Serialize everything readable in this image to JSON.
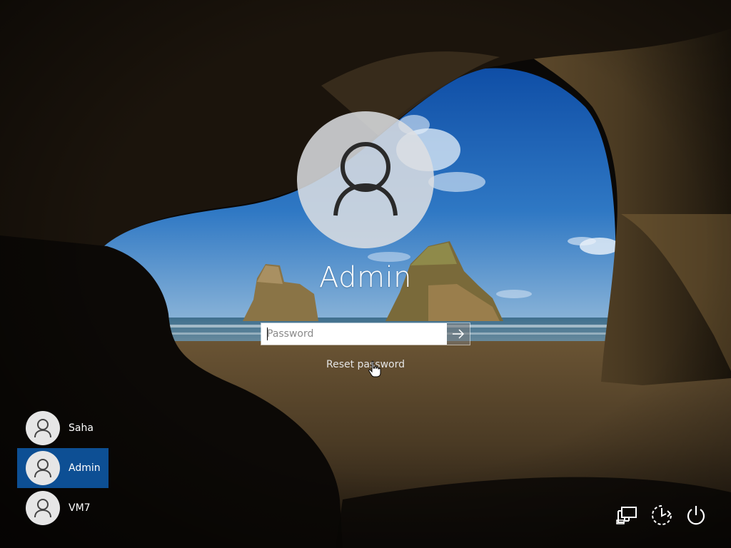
{
  "login": {
    "selected_user": "Admin",
    "password_placeholder": "Password",
    "password_value": "",
    "reset_link": "Reset password"
  },
  "users": [
    {
      "name": "Saha",
      "selected": false
    },
    {
      "name": "Admin",
      "selected": true
    },
    {
      "name": "VM7",
      "selected": false
    }
  ],
  "tray": [
    {
      "icon": "network-icon"
    },
    {
      "icon": "ease-of-access-icon"
    },
    {
      "icon": "power-icon"
    }
  ],
  "colors": {
    "selected_tile": "#0d4f94",
    "text": "#ffffff"
  }
}
